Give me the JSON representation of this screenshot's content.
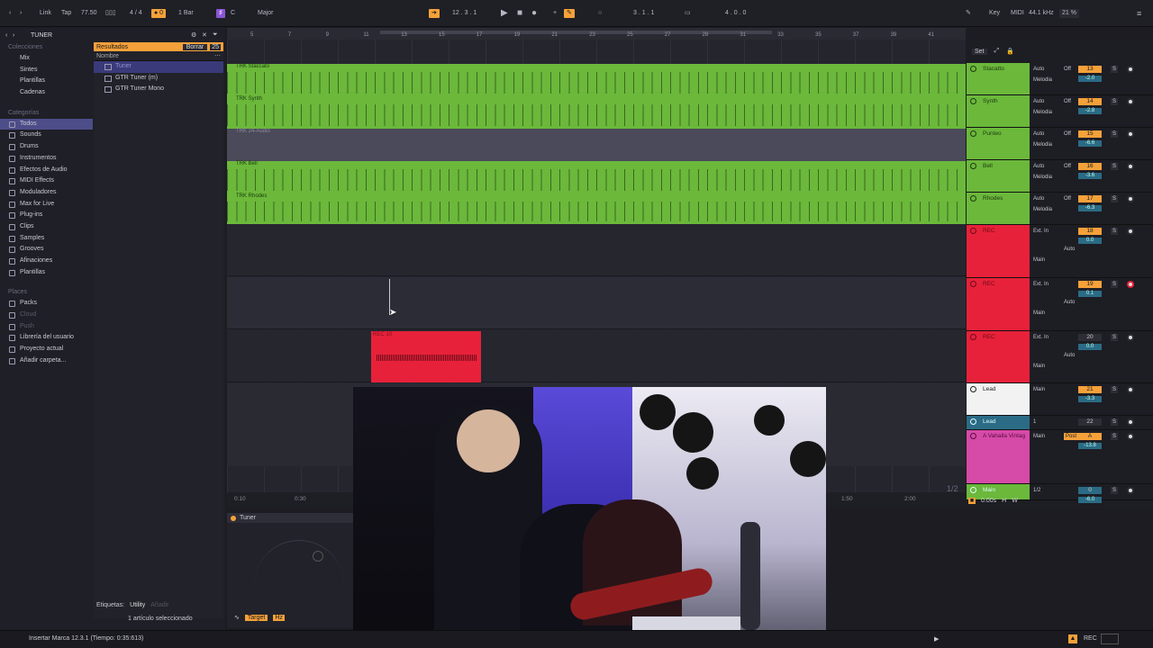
{
  "topbar": {
    "link": "Link",
    "tap": "Tap",
    "tempo": "77.50",
    "time_sig": "4 / 4",
    "quant": "1 Bar",
    "key_root": "C",
    "scale": "Major",
    "position": "12 .   3 .   1",
    "loop_start": "3 .   1 .   1",
    "loop_len": "4 .   0 .   0",
    "key_label": "Key",
    "midi_label": "MIDI",
    "sample_rate": "44.1 kHz",
    "cpu": "21 %",
    "colors": {
      "accent": "#f5a13a",
      "purple": "#8a55d6",
      "green": "#6bb83b",
      "red": "#e8213a"
    }
  },
  "browser": {
    "search_value": "TUNER",
    "collections_title": "Colecciones",
    "collections": [
      {
        "label": "Mix",
        "color": "#e8213a"
      },
      {
        "label": "Sintes",
        "color": "#e84a7a"
      },
      {
        "label": "Plantillas",
        "color": "#39b5d6"
      },
      {
        "label": "Cadenas",
        "color": "#ffffff"
      }
    ],
    "categories_title": "Categorías",
    "categories": [
      "Todos",
      "Sounds",
      "Drums",
      "Instrumentos",
      "Efectos de Audio",
      "MIDI Effects",
      "Moduladores",
      "Max for Live",
      "Plug-ins",
      "Clips",
      "Samples",
      "Grooves",
      "Afinaciones",
      "Plantillas"
    ],
    "places_title": "Places",
    "places": [
      "Packs",
      "Cloud",
      "Push",
      "Librería del usuario",
      "Proyecto actual",
      "Añadir carpeta..."
    ],
    "results_label": "Resultados",
    "clear_label": "Borrar",
    "col_name": "Nombre",
    "results": [
      "Tuner",
      "GTR Tuner (m)",
      "GTR Tuner Mono"
    ],
    "tags_label": "Etiquetas:",
    "tag_utility": "Utility",
    "tag_add": "Añadir",
    "selected_info": "1 artículo seleccionado"
  },
  "ruler": [
    "5",
    "7",
    "9",
    "11",
    "13",
    "15",
    "17",
    "19",
    "21",
    "23",
    "25",
    "27",
    "29",
    "31",
    "33",
    "35",
    "37",
    "39",
    "41"
  ],
  "timeline": [
    "0:10",
    "0:30",
    "1:50",
    "2:00"
  ],
  "clips": [
    "TRK Staccato",
    "TRK Synth",
    "TRK 24-Audio",
    "TRK Bell",
    "TRK Rhodes",
    "REC 10"
  ],
  "mixer": {
    "set_label": "Set",
    "tracks": [
      {
        "name": "Stacatto",
        "input": "Auto",
        "monitor": "Off",
        "chain": "Melodia",
        "number": "13",
        "vol": "-2.0"
      },
      {
        "name": "Synth",
        "input": "Auto",
        "monitor": "Off",
        "chain": "Melodia",
        "number": "14",
        "vol": "-2.8"
      },
      {
        "name": "Punteo",
        "input": "Auto",
        "monitor": "Off",
        "chain": "Melodia",
        "number": "15",
        "vol": "-6.6"
      },
      {
        "name": "Bell",
        "input": "Auto",
        "monitor": "Off",
        "chain": "Melodia",
        "number": "16",
        "vol": "-3.6"
      },
      {
        "name": "Rhodes",
        "input": "Auto",
        "monitor": "Off",
        "chain": "Melodia",
        "number": "17",
        "vol": "-6.3"
      },
      {
        "name": "REC",
        "input": "Ext. In",
        "monitor": "Auto",
        "chain": "Main",
        "number": "18",
        "vol": "0.0"
      },
      {
        "name": "REC",
        "input": "Ext. In",
        "monitor": "Auto",
        "chain": "Main",
        "number": "19",
        "vol": "0.1"
      },
      {
        "name": "REC",
        "input": "Ext. In",
        "monitor": "Auto",
        "chain": "Main",
        "number": "20",
        "vol": "0.0"
      },
      {
        "name": "Lead",
        "input": "Main",
        "monitor": "",
        "chain": "",
        "number": "21",
        "vol": "-3.3"
      },
      {
        "name": "Lead",
        "input": "1",
        "monitor": "",
        "chain": "",
        "number": "22",
        "vol": ""
      },
      {
        "name": "A Vahalla Vintag",
        "input": "Main",
        "monitor": "Post",
        "chain": "",
        "number": "A",
        "vol": "-13.8"
      },
      {
        "name": "Main",
        "input": "1/2",
        "monitor": "",
        "chain": "",
        "number": "0",
        "vol": "-6.0"
      }
    ],
    "page_indicator": "1/2",
    "zoom": "0.00s",
    "h_label": "H",
    "w_label": "W"
  },
  "device": {
    "title": "Tuner",
    "target": "Target",
    "hz": "Hz"
  },
  "status": {
    "message": "Insertar Marca 12.3.1 (Tiempo: 0:35:613)",
    "rec": "REC"
  }
}
